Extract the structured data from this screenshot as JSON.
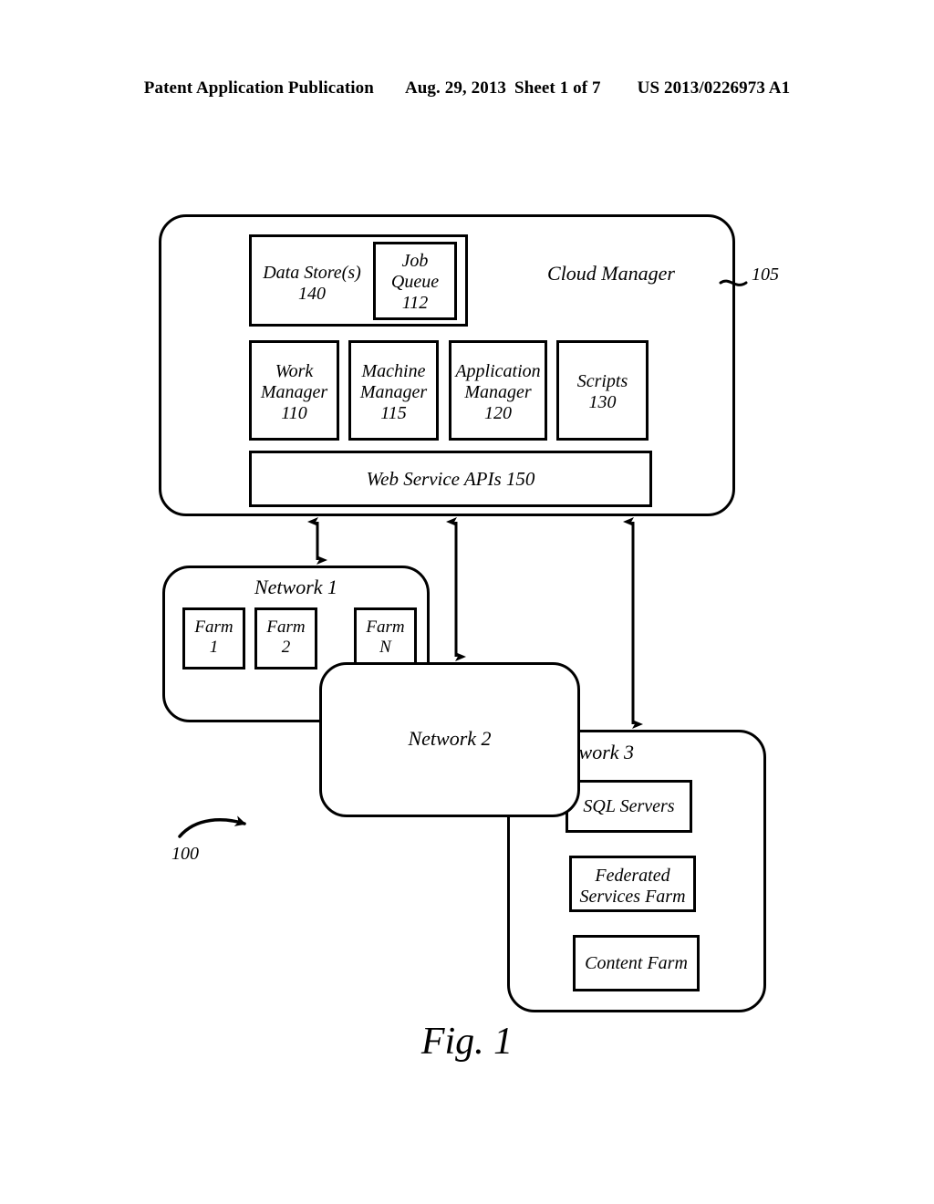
{
  "header": {
    "publication": "Patent Application Publication",
    "date": "Aug. 29, 2013",
    "sheet": "Sheet 1 of 7",
    "patent_number": "US 2013/0226973 A1"
  },
  "figure": {
    "caption": "Fig. 1",
    "system_reference": "100",
    "cloud_manager": {
      "title": "Cloud Manager",
      "reference": "105",
      "data_store": {
        "label": "Data Store(s)",
        "number": "140"
      },
      "job_queue": {
        "label": "Job\nQueue",
        "number": "112"
      },
      "components": [
        {
          "label": "Work\nManager",
          "number": "110"
        },
        {
          "label": "Machine\nManager",
          "number": "115"
        },
        {
          "label": "Application\nManager",
          "number": "120"
        },
        {
          "label": "Scripts",
          "number": "130"
        }
      ],
      "web_service_apis": "Web Service APIs 150"
    },
    "networks": [
      {
        "name": "Network 1",
        "nodes": [
          {
            "label": "Farm\n1"
          },
          {
            "label": "Farm\n2"
          },
          {
            "label": "Farm\nN"
          }
        ]
      },
      {
        "name": "Network 2",
        "nodes": []
      },
      {
        "name": "Network 3",
        "nodes": [
          {
            "label": "SQL Servers"
          },
          {
            "label": "Federated\nServices Farm"
          },
          {
            "label": "Content Farm"
          }
        ]
      }
    ]
  }
}
